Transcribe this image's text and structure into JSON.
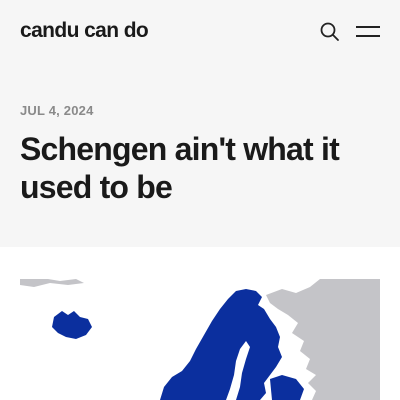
{
  "header": {
    "site_name": "candu can do",
    "search_icon": "search-icon",
    "menu_icon": "hamburger-menu-icon"
  },
  "post": {
    "date": "JUL 4, 2024",
    "title": "Schengen ain't what it used to be"
  },
  "colors": {
    "hero_background": "#f6f6f6",
    "schengen_blue": "#0b2f9e",
    "non_schengen_grey": "#c4c4c8",
    "map_water": "#ffffff"
  }
}
